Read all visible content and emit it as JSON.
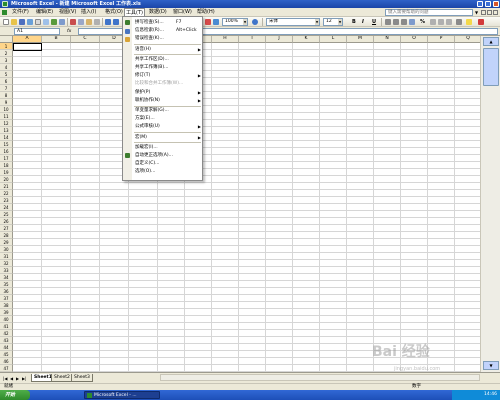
{
  "window": {
    "title": "Microsoft Excel - 新建 Microsoft Excel 工作表.xls"
  },
  "menubar": {
    "items": [
      "文件(F)",
      "编辑(E)",
      "视图(V)",
      "插入(I)",
      "格式(O)",
      "工具(T)",
      "数据(D)",
      "窗口(W)",
      "帮助(H)"
    ],
    "active": "工具(T)",
    "help_placeholder": "键入需要帮助的问题"
  },
  "toolbar": {
    "zoom": "100%",
    "font_name": "宋体",
    "font_size": "12",
    "bold": "B",
    "italic": "I",
    "underline": "U",
    "percent": "%"
  },
  "formula_bar": {
    "name_box": "A1",
    "fx": "fx",
    "formula": ""
  },
  "grid": {
    "columns": [
      "A",
      "B",
      "C",
      "D",
      "E",
      "F",
      "G",
      "H",
      "I",
      "J",
      "K",
      "L",
      "M",
      "N",
      "O",
      "P",
      "Q"
    ],
    "rows": [
      "1",
      "2",
      "3",
      "4",
      "5",
      "6",
      "7",
      "8",
      "9",
      "10",
      "11",
      "12",
      "13",
      "14",
      "15",
      "16",
      "17",
      "18",
      "19",
      "20",
      "21",
      "22",
      "23",
      "24",
      "25",
      "26",
      "27",
      "28",
      "29",
      "30",
      "31",
      "32",
      "33",
      "34",
      "35",
      "36",
      "37",
      "38",
      "39",
      "40",
      "41",
      "42",
      "43",
      "44",
      "45",
      "46",
      "47"
    ],
    "active_cell": "A1"
  },
  "tools_menu": {
    "items": [
      {
        "label": "拼写检查(S)...",
        "shortcut": "F7",
        "icon": "spellcheck-icon",
        "disabled": false,
        "submenu": false
      },
      {
        "label": "信息检索(R)...",
        "shortcut": "Alt+Click",
        "icon": "research-icon",
        "disabled": false,
        "submenu": false
      },
      {
        "label": "错误检查(K)...",
        "shortcut": "",
        "icon": "error-check-icon",
        "disabled": false,
        "submenu": false
      },
      {
        "label": "语音(H)",
        "shortcut": "",
        "icon": "",
        "disabled": false,
        "submenu": true
      },
      {
        "label": "共享工作区(D)...",
        "shortcut": "",
        "icon": "",
        "disabled": false,
        "submenu": false
      },
      {
        "label": "共享工作簿(B)...",
        "shortcut": "",
        "icon": "",
        "disabled": false,
        "submenu": false
      },
      {
        "label": "修订(T)",
        "shortcut": "",
        "icon": "",
        "disabled": false,
        "submenu": true
      },
      {
        "label": "比较和合并工作簿(W)...",
        "shortcut": "",
        "icon": "",
        "disabled": true,
        "submenu": false
      },
      {
        "label": "保护(P)",
        "shortcut": "",
        "icon": "",
        "disabled": false,
        "submenu": true
      },
      {
        "label": "联机协作(N)",
        "shortcut": "",
        "icon": "",
        "disabled": false,
        "submenu": true
      },
      {
        "label": "单变量求解(G)...",
        "shortcut": "",
        "icon": "",
        "disabled": false,
        "submenu": false
      },
      {
        "label": "方案(E)...",
        "shortcut": "",
        "icon": "",
        "disabled": false,
        "submenu": false
      },
      {
        "label": "公式审核(U)",
        "shortcut": "",
        "icon": "",
        "disabled": false,
        "submenu": true
      },
      {
        "label": "宏(M)",
        "shortcut": "",
        "icon": "",
        "disabled": false,
        "submenu": true
      },
      {
        "label": "加载宏(I)...",
        "shortcut": "",
        "icon": "",
        "disabled": false,
        "submenu": false
      },
      {
        "label": "自动更正选项(A)...",
        "shortcut": "",
        "icon": "autocorrect-icon",
        "disabled": false,
        "submenu": false
      },
      {
        "label": "自定义(C)...",
        "shortcut": "",
        "icon": "",
        "disabled": false,
        "submenu": false
      },
      {
        "label": "选项(O)...",
        "shortcut": "",
        "icon": "",
        "disabled": false,
        "submenu": false
      }
    ]
  },
  "sheets": {
    "tabs": [
      "Sheet1",
      "Sheet2",
      "Sheet3"
    ],
    "active": "Sheet1"
  },
  "statusbar": {
    "left": "就绪",
    "num": "数字"
  },
  "taskbar": {
    "start": "开始",
    "task_label": "Microsoft Excel - ...",
    "clock": "14:46"
  },
  "watermark": {
    "text": "Bai 经验",
    "sub": "jingyan.baidu.com"
  }
}
